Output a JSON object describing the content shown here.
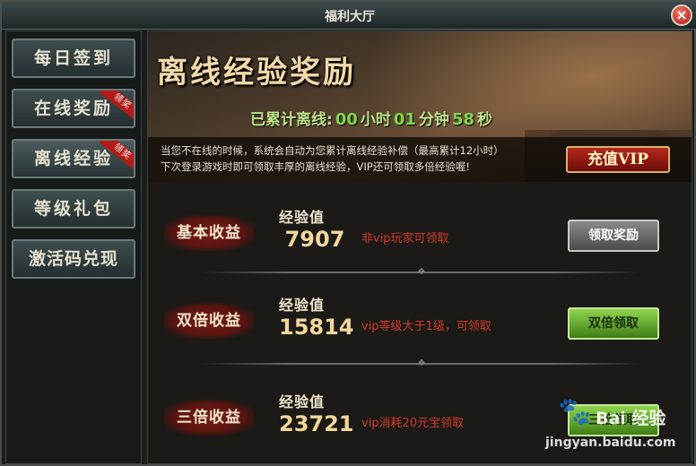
{
  "window": {
    "title": "福利大厅",
    "close_icon": "×"
  },
  "sidebar": {
    "items": [
      {
        "label": "每日签到"
      },
      {
        "label": "在线奖励",
        "badge": "领奖"
      },
      {
        "label": "离线经验",
        "badge": "领奖"
      },
      {
        "label": "等级礼包"
      },
      {
        "label": "激活码兑现"
      }
    ]
  },
  "banner": {
    "title": "离线经验奖励",
    "offline_prefix": "已累计离线:",
    "hours": "00",
    "hours_unit": "小时",
    "minutes": "01",
    "minutes_unit": "分钟",
    "seconds": "58",
    "seconds_unit": "秒",
    "desc_line1": "当您不在线的时候，系统会自动为您累计离线经验补偿（最高累计12小时）",
    "desc_line2": "下次登录游戏时即可领取丰厚的离线经验，VIP还可领取多倍经验喔!",
    "vip_button": "充值VIP"
  },
  "rewards": [
    {
      "label": "基本收益",
      "exp_label": "经验值",
      "exp_value": "7907",
      "condition": "非vip玩家可领取",
      "button": "领取奖励",
      "button_style": "gray"
    },
    {
      "label": "双倍收益",
      "exp_label": "经验值",
      "exp_value": "15814",
      "condition": "vip等级大于1级，可领取",
      "button": "双倍领取",
      "button_style": "green"
    },
    {
      "label": "三倍收益",
      "exp_label": "经验值",
      "exp_value": "23721",
      "condition": "vip消耗20元宝领取",
      "button": "三倍领取",
      "button_style": "green"
    }
  ],
  "watermark": {
    "text": "Bai 经验",
    "url": "jingyan.baidu.com",
    "paw_icon": "🐾"
  }
}
